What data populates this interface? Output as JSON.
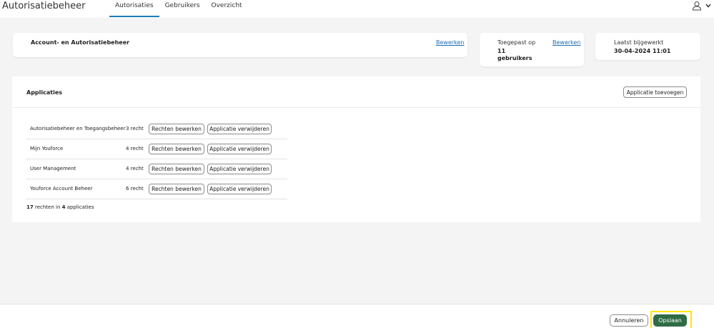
{
  "header": {
    "app_title": "Autorisatiebeheer",
    "tabs": [
      {
        "label": "Autorisaties",
        "active": true
      },
      {
        "label": "Gebruikers",
        "active": false
      },
      {
        "label": "Overzicht",
        "active": false
      }
    ]
  },
  "summary_card": {
    "title": "Account- en Autorisatiebeheer",
    "edit_link": "Bewerken"
  },
  "applied_card": {
    "label": "Toegepast op",
    "count": "11",
    "unit": "gebruikers",
    "edit_link": "Bewerken"
  },
  "updated_card": {
    "label": "Laatst bijgewerkt",
    "value": "30-04-2024 11:01"
  },
  "applications": {
    "title": "Applicaties",
    "add_button": "Applicatie toevoegen",
    "edit_rights_label": "Rechten bewerken",
    "remove_label": "Applicatie verwijderen",
    "rows": [
      {
        "name": "Autorisatiebeheer en Toegangsbeheer",
        "count": "3 recht"
      },
      {
        "name": "Mijn Youforce",
        "count": "4 recht"
      },
      {
        "name": "User Management",
        "count": "4 recht"
      },
      {
        "name": "Youforce Account Beheer",
        "count": "6 recht"
      }
    ],
    "summary": {
      "rights": "17",
      "rights_text": "rechten in",
      "apps": "4",
      "apps_text": "applicaties"
    }
  },
  "footer": {
    "cancel_label": "Annuleren",
    "save_label": "Opslaan"
  },
  "colors": {
    "accent": "#1e7bb8",
    "save_green": "#2f6b45",
    "highlight": "#ffe600"
  }
}
